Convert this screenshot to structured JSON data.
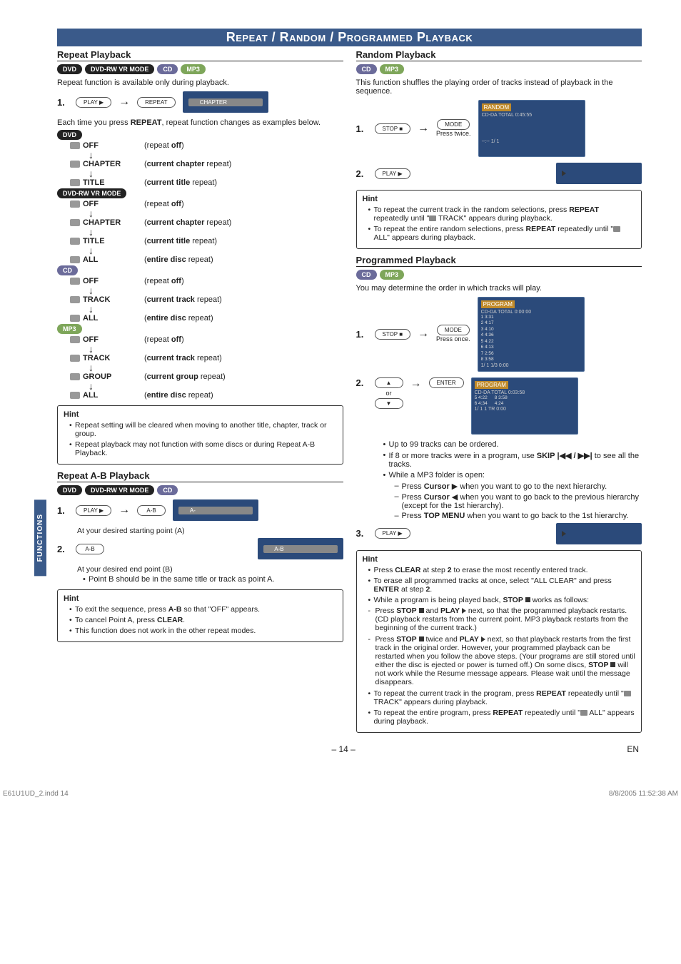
{
  "sideTab": "FUNCTIONS",
  "banner": "Repeat / Random / Programmed Playback",
  "left": {
    "repeatPlayback": {
      "title": "Repeat Playback",
      "badges": [
        "DVD",
        "DVD-RW VR MODE",
        "CD",
        "MP3"
      ],
      "intro": "Repeat function is available only during playback.",
      "step1Btn1": "PLAY ▶",
      "step1Btn2": "REPEAT",
      "step1Osd": "CHAPTER",
      "caption": "Each time you press REPEAT, repeat function changes as examples below.",
      "groups": [
        {
          "badge": "DVD",
          "items": [
            {
              "label": "OFF",
              "desc_pre": "(repeat ",
              "desc_bold": "off",
              "desc_post": ")"
            },
            {
              "label": "CHAPTER",
              "desc_pre": "(",
              "desc_bold": "current chapter",
              "desc_post": " repeat)"
            },
            {
              "label": "TITLE",
              "desc_pre": "(",
              "desc_bold": "current title",
              "desc_post": " repeat)"
            }
          ]
        },
        {
          "badge": "DVD-RW VR MODE",
          "items": [
            {
              "label": "OFF",
              "desc_pre": "(repeat ",
              "desc_bold": "off",
              "desc_post": ")"
            },
            {
              "label": "CHAPTER",
              "desc_pre": "(",
              "desc_bold": "current chapter",
              "desc_post": " repeat)"
            },
            {
              "label": "TITLE",
              "desc_pre": "(",
              "desc_bold": "current title",
              "desc_post": " repeat)"
            },
            {
              "label": "ALL",
              "desc_pre": "(",
              "desc_bold": "entire disc",
              "desc_post": " repeat)"
            }
          ]
        },
        {
          "badge": "CD",
          "items": [
            {
              "label": "OFF",
              "desc_pre": "(repeat ",
              "desc_bold": "off",
              "desc_post": ")"
            },
            {
              "label": "TRACK",
              "desc_pre": "(",
              "desc_bold": "current track",
              "desc_post": " repeat)"
            },
            {
              "label": "ALL",
              "desc_pre": "(",
              "desc_bold": "entire disc",
              "desc_post": " repeat)"
            }
          ]
        },
        {
          "badge": "MP3",
          "items": [
            {
              "label": "OFF",
              "desc_pre": "(repeat ",
              "desc_bold": "off",
              "desc_post": ")"
            },
            {
              "label": "TRACK",
              "desc_pre": "(",
              "desc_bold": "current track",
              "desc_post": " repeat)"
            },
            {
              "label": "GROUP",
              "desc_pre": "(",
              "desc_bold": "current group",
              "desc_post": " repeat)"
            },
            {
              "label": "ALL",
              "desc_pre": "(",
              "desc_bold": "entire disc",
              "desc_post": " repeat)"
            }
          ]
        }
      ],
      "hintTitle": "Hint",
      "hints": [
        "Repeat setting will be cleared when moving to another title, chapter, track or group.",
        "Repeat playback may not function with some discs or during Repeat A-B Playback."
      ]
    },
    "repeatAB": {
      "title": "Repeat A-B Playback",
      "badges": [
        "DVD",
        "DVD-RW VR MODE",
        "CD"
      ],
      "step1Btn1": "PLAY ▶",
      "step1Btn2": "A-B",
      "step1Osd": "A-",
      "step1Note": "At your desired starting point (A)",
      "step2Btn": "A-B",
      "step2Osd": "A-B",
      "step2Note": "At your desired end point (B)",
      "step2Bullet": "Point B should be in the same title or track as point A.",
      "hintTitle": "Hint",
      "hints": [
        "To exit the sequence, press A-B so that \"OFF\" appears.",
        "To cancel Point A, press CLEAR.",
        "This function does not work in the other repeat modes."
      ]
    }
  },
  "right": {
    "random": {
      "title": "Random Playback",
      "badges": [
        "CD",
        "MP3"
      ],
      "intro": "This function shuffles the playing order of tracks instead of playback in the sequence.",
      "step1Btn1": "STOP ■",
      "step1Btn2": "MODE",
      "step1Note": "Press twice.",
      "osdHeader": "RANDOM",
      "osdLine1": "CD-DA    TOTAL 0:45:55",
      "osdLine2": "--:-- 1/ 1",
      "step2Btn": "PLAY ▶",
      "hintTitle": "Hint",
      "hints": [
        "To repeat the current track in the random selections, press REPEAT repeatedly until \"🔁 TRACK\" appears during playback.",
        "To repeat the entire random selections, press REPEAT repeatedly until \"🔁 ALL\" appears during playback."
      ]
    },
    "programmed": {
      "title": "Programmed Playback",
      "badges": [
        "CD",
        "MP3"
      ],
      "intro": "You may determine the order in which tracks will play.",
      "step1Btn1": "STOP ■",
      "step1Btn2": "MODE",
      "step1Note": "Press once.",
      "osd1Header": "PROGRAM",
      "osd1Top": "CD-DA    TOTAL 0:00:00",
      "osd1Rows": [
        "1  3:31",
        "2  4:17",
        "3  4:10",
        "4  4:36",
        "5  4:22",
        "6  4:13",
        "7  2:56",
        "8  3:58"
      ],
      "osd1Foot": "1/ 1    1/3  0:00",
      "step2BtnUp": "▲",
      "step2Or": "or",
      "step2BtnDown": "▼",
      "step2BtnEnter": "ENTER",
      "osd2Header": "PROGRAM",
      "osd2Top": "CD-DA    TOTAL 0:03:58",
      "osd2Left": [
        "5  4:22",
        "6  4:34"
      ],
      "osd2Right": [
        "8  3:58",
        "   4:24"
      ],
      "osd2Foot": "1/ 1    1 TR  0:00",
      "step2Bullets": [
        "Up to 99 tracks can be ordered.",
        "If 8 or more tracks were in a program, use SKIP |◀◀ / ▶▶| to see all the tracks.",
        "While a MP3 folder is open:"
      ],
      "step2SubBullets": [
        "Press Cursor ▶ when you want to go to the next hierarchy.",
        "Press Cursor ◀ when you want to go back to the previous hierarchy (except for the 1st hierarchy).",
        "Press TOP MENU when you want to go back to the 1st hierarchy."
      ],
      "step3Btn": "PLAY ▶",
      "hintTitle": "Hint",
      "hints": [
        "Press CLEAR at step 2 to erase the most recently entered track.",
        "To erase all programmed tracks at once, select \"ALL CLEAR\" and press ENTER at step 2.",
        "While a program is being played back, STOP ■ works as follows:"
      ],
      "hintDash": [
        "Press STOP ■ and PLAY ▶ next, so that the programmed playback restarts. (CD playback restarts from the current point. MP3 playback restarts from the beginning of the current track.)",
        "Press STOP ■ twice and PLAY ▶ next, so that playback restarts from the first track in the original order. However, your programmed playback can be restarted when you follow the above steps. (Your programs are still stored until either the disc is ejected or power is turned off.) On some discs, STOP ■ will not work while the Resume message appears. Please wait until the message disappears."
      ],
      "hintsAfter": [
        "To repeat the current track in the program, press REPEAT repeatedly until \"🔁 TRACK\" appears during playback.",
        "To repeat the entire program, press REPEAT repeatedly until \"🔁 ALL\" appears during playback."
      ]
    }
  },
  "pageFooter": {
    "center": "– 14 –",
    "right": "EN",
    "fileLeft": "E61U1UD_2.indd   14",
    "fileRight": "8/8/2005   11:52:38 AM"
  }
}
